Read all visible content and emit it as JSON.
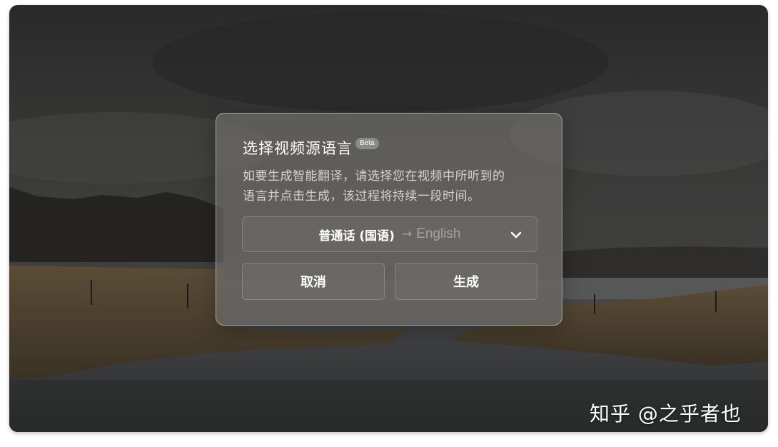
{
  "dialog": {
    "title": "选择视频源语言",
    "badge": "Beta",
    "description_line1": "如要生成智能翻译，请选择您在视频中所听到的",
    "description_line2": "语言并点击生成，该过程将持续一段时间。",
    "select": {
      "source_language": "普通话 (国语)",
      "arrow": "→",
      "target_language": "English",
      "icon": "chevron-down-icon"
    },
    "cancel_label": "取消",
    "generate_label": "生成"
  },
  "watermark": "知乎 @之乎者也"
}
